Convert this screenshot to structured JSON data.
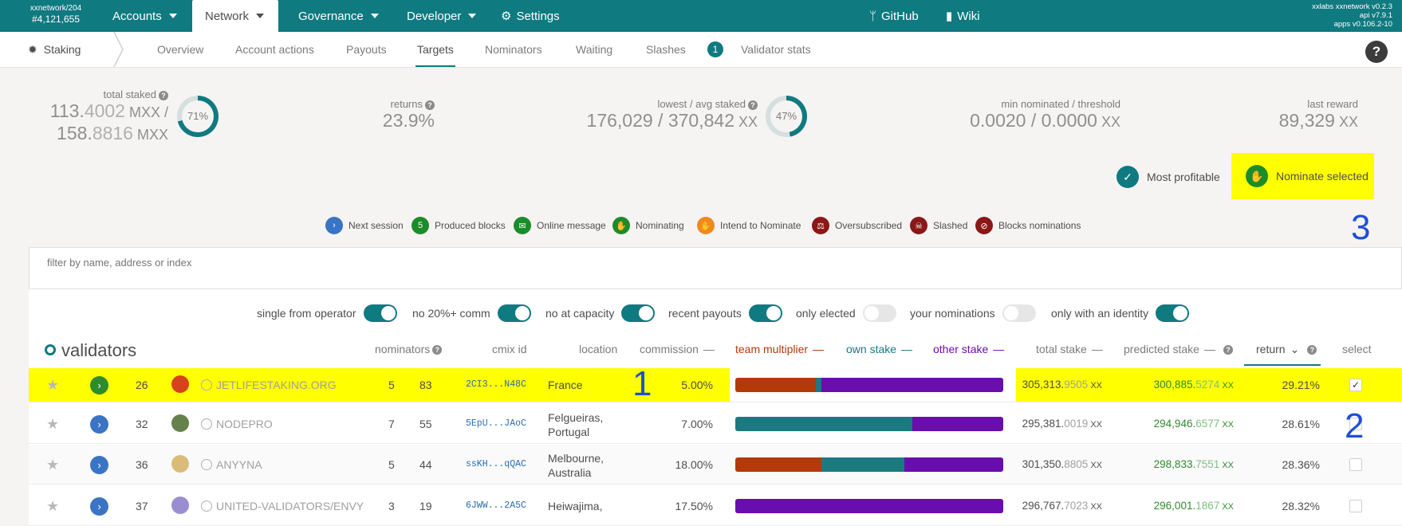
{
  "chain": {
    "name": "xxnetwork/204",
    "block": "#4,121,655"
  },
  "menu": {
    "accounts": "Accounts",
    "network": "Network",
    "governance": "Governance",
    "developer": "Developer",
    "settings": "Settings",
    "github": "GitHub",
    "wiki": "Wiki"
  },
  "versions": {
    "line1": "xxlabs xxnetwork v0.2.3",
    "line2": "api v7.9.1",
    "line3": "apps v0.106.2-10"
  },
  "subnav": {
    "section": "Staking",
    "tabs": [
      "Overview",
      "Account actions",
      "Payouts",
      "Targets",
      "Nominators",
      "Waiting",
      "Slashes"
    ],
    "badge": "1",
    "validator_stats": "Validator stats",
    "help": "?"
  },
  "stats": {
    "total_staked_label": "total staked",
    "total_line1_a": "113.",
    "total_line1_b": "4002",
    "total_line1_unit": " MXX /",
    "total_line2_a": "158.",
    "total_line2_b": "8816",
    "total_line2_unit": " MXX",
    "total_pct": "71%",
    "returns_label": "returns",
    "returns_val": "23.9%",
    "lowavg_label": "lowest / avg staked",
    "lowavg_val": "176,029 / 370,842",
    "lowavg_unit": " XX",
    "lowavg_pct": "47%",
    "minnom_label": "min nominated / threshold",
    "minnom_val": "0.0020 / 0.0000",
    "minnom_unit": " XX",
    "lastreward_label": "last reward",
    "lastreward_val": "89,329",
    "lastreward_unit": " XX"
  },
  "buttons": {
    "most_profitable": "Most profitable",
    "nominate_selected": "Nominate selected"
  },
  "legend": [
    {
      "icon": "chevron-right",
      "label": "Next session",
      "color": "#3a74c4"
    },
    {
      "icon": "5",
      "label": "Produced blocks",
      "color": "#1c8c2a"
    },
    {
      "icon": "envelope",
      "label": "Online message",
      "color": "#1c8c2a"
    },
    {
      "icon": "hand",
      "label": "Nominating",
      "color": "#1c8c2a"
    },
    {
      "icon": "hand",
      "label": "Intend to Nominate",
      "color": "#f08a1d"
    },
    {
      "icon": "scale",
      "label": "Oversubscribed",
      "color": "#8b1717"
    },
    {
      "icon": "skull",
      "label": "Slashed",
      "color": "#8b1717"
    },
    {
      "icon": "user-slash",
      "label": "Blocks nominations",
      "color": "#8b1717"
    }
  ],
  "filter": {
    "placeholder": "filter by name, address or index"
  },
  "toggles": [
    {
      "label": "single from operator",
      "on": true
    },
    {
      "label": "no 20%+ comm",
      "on": true
    },
    {
      "label": "no at capacity",
      "on": true
    },
    {
      "label": "recent payouts",
      "on": true
    },
    {
      "label": "only elected",
      "on": false
    },
    {
      "label": "your nominations",
      "on": false
    },
    {
      "label": "only with an identity",
      "on": true
    }
  ],
  "table": {
    "title": "validators",
    "headers": {
      "nominators": "nominators",
      "cmix": "cmix id",
      "location": "location",
      "commission": "commission",
      "team": "team multiplier",
      "own": "own stake",
      "other": "other stake",
      "total": "total stake",
      "predicted": "predicted stake",
      "return": "return",
      "select": "select"
    },
    "rows": [
      {
        "rank": "26",
        "name": "JETLIFESTAKING.ORG",
        "nom_a": "5",
        "nom_b": "83",
        "cmix": "2CI3...N48C",
        "loc1": "France",
        "loc2": "",
        "commission": "5.00%",
        "team": 0.3,
        "own": 0.02,
        "other": 0.68,
        "total_a": "305,313.",
        "total_b": "9505",
        "pred_a": "300,885.",
        "pred_b": "5274",
        "unit": " XX",
        "ret": "29.21%",
        "selected": true,
        "highlight": true
      },
      {
        "rank": "32",
        "name": "NODEPRO",
        "nom_a": "7",
        "nom_b": "55",
        "cmix": "5EpU...JAoC",
        "loc1": "Felgueiras,",
        "loc2": "Portugal",
        "commission": "7.00%",
        "team": 0.0,
        "own": 0.66,
        "other": 0.34,
        "total_a": "295,381.",
        "total_b": "0019",
        "pred_a": "294,946.",
        "pred_b": "6577",
        "unit": " XX",
        "ret": "28.61%",
        "selected": false,
        "highlight": false
      },
      {
        "rank": "36",
        "name": "ANYYNA",
        "nom_a": "5",
        "nom_b": "44",
        "cmix": "ssKH...qQAC",
        "loc1": "Melbourne,",
        "loc2": "Australia",
        "commission": "18.00%",
        "team": 0.32,
        "own": 0.31,
        "other": 0.37,
        "total_a": "301,350.",
        "total_b": "8805",
        "pred_a": "298,833.",
        "pred_b": "7551",
        "unit": " XX",
        "ret": "28.36%",
        "selected": false,
        "highlight": false
      },
      {
        "rank": "37",
        "name": "UNITED-VALIDATORS/ENVY",
        "nom_a": "3",
        "nom_b": "19",
        "cmix": "6JWW...2A5C",
        "loc1": "Heiwajima,",
        "loc2": "",
        "commission": "17.50%",
        "team": 0.0,
        "own": 0.0,
        "other": 1.0,
        "total_a": "296,767.",
        "total_b": "7023",
        "pred_a": "296,001.",
        "pred_b": "1867",
        "unit": " XX",
        "ret": "28.32%",
        "selected": false,
        "highlight": false
      }
    ]
  },
  "annotations": {
    "n1": "1",
    "n2": "2",
    "n3": "3"
  },
  "colors": {
    "teal": "#0f7a80",
    "team": "#b43a0a",
    "own": "#1a7a80",
    "other": "#6a0dad",
    "highlight": "#ffff00"
  }
}
